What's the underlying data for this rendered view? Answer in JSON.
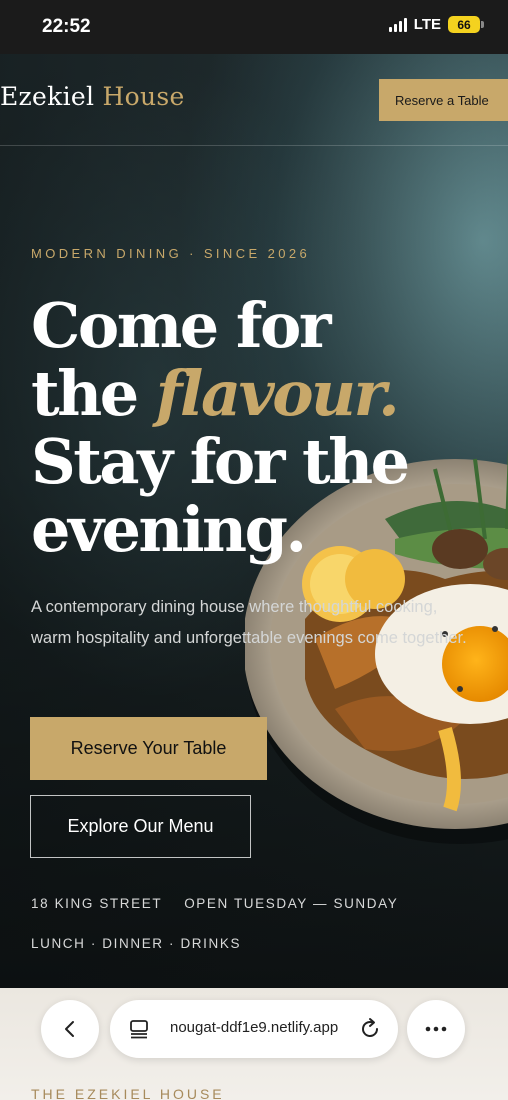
{
  "status_bar": {
    "time": "22:52",
    "network": "LTE",
    "battery": "66"
  },
  "header": {
    "logo_part1": "Ezekiel",
    "logo_part2": "House",
    "reserve_label": "Reserve a Table"
  },
  "hero": {
    "kicker": "MODERN DINING · SINCE 2026",
    "headline_part1": "Come for the",
    "headline_accent": "flavour.",
    "headline_part2": "Stay for the evening.",
    "lede": "A contemporary dining house where thoughtful cooking, warm hospitality and unforgettable evenings come together.",
    "primary_button": "Reserve Your Table",
    "secondary_button": "Explore Our Menu",
    "address": "18 KING STREET",
    "hours": "OPEN TUESDAY — SUNDAY",
    "services": "LUNCH · DINNER · DRINKS"
  },
  "browser": {
    "url": "nougat-ddf1e9.netlify.app"
  },
  "footer_peek": "THE EZEKIEL HOUSE",
  "colors": {
    "accent_gold": "#c8a86a",
    "status_battery": "#f4d21f",
    "hero_teal": "#3c6468"
  }
}
